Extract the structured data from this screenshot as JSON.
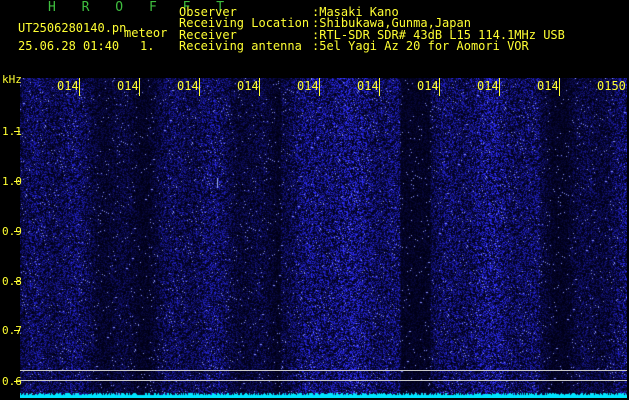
{
  "header": {
    "title": "H R O F F T",
    "filename": "UT2506280140.pn",
    "label_meteor": "meteor",
    "datetime": "25.06.28 01:40",
    "count": "1.",
    "fields": [
      {
        "label": "Observer",
        "value": ":Masaki Kano"
      },
      {
        "label": "Receiving Location",
        "value": ":Shibukawa,Gunma,Japan"
      },
      {
        "label": "Receiver",
        "value": ":RTL-SDR SDR# 43dB L15 114.1MHz USB"
      },
      {
        "label": "Receiving antenna",
        "value": ":5el Yagi Az 20 for Aomori VOR"
      }
    ]
  },
  "y_axis": {
    "unit": "kHz",
    "ticks": [
      "1.1",
      "1.0",
      "0.9",
      "0.8",
      "0.7",
      "0.6"
    ]
  },
  "time_axis": {
    "labels": [
      "014",
      "014",
      "014",
      "014",
      "014",
      "014",
      "014",
      "014",
      "014",
      "0150"
    ]
  },
  "colors": {
    "background": "#000000",
    "signal": "#1a22c8",
    "noise_floor": "#00e5ff",
    "text": "#ffff33",
    "title": "#3fbf3f"
  }
}
